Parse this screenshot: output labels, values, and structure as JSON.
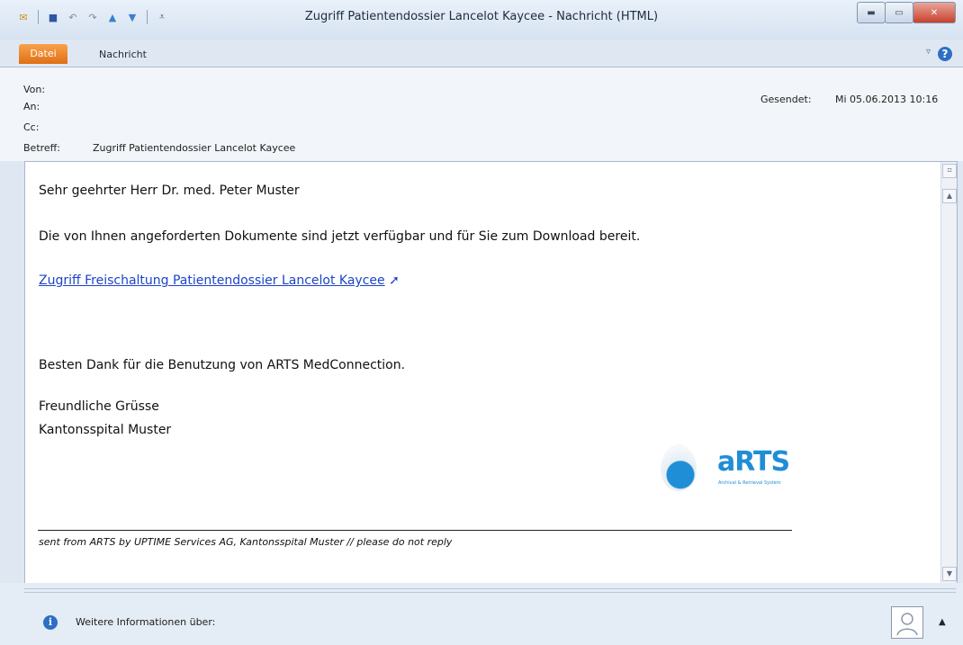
{
  "window": {
    "title": "Zugriff Patientendossier Lancelot Kaycee - Nachricht (HTML)",
    "minimize_glyph": "▬",
    "maximize_glyph": "▭",
    "close_glyph": "✕"
  },
  "qat": {
    "mail_glyph": "✉",
    "save_glyph": "■",
    "undo_glyph": "↶",
    "redo_glyph": "↷",
    "up_glyph": "▲",
    "down_glyph": "▼",
    "customize_glyph": "⩡"
  },
  "ribbon": {
    "tabs": [
      "Datei",
      "Nachricht"
    ],
    "collapse_glyph": "▿",
    "help_glyph": "?"
  },
  "header": {
    "from_label": "Von:",
    "to_label": "An:",
    "cc_label": "Cc:",
    "subject_label": "Betreff:",
    "subject_value": "Zugriff Patientendossier Lancelot Kaycee",
    "sent_label": "Gesendet:",
    "sent_value": "Mi 05.06.2013 10:16"
  },
  "message": {
    "greeting": "Sehr geehrter Herr Dr. med. Peter Muster",
    "line1": "Die von Ihnen angeforderten Dokumente sind jetzt verfügbar und für Sie zum Download bereit.",
    "link_text": "Zugriff Freischaltung Patientendossier Lancelot Kaycee",
    "link_glyph": "➚",
    "thanks": "Besten Dank für die Benutzung von ARTS MedConnection.",
    "closing": "Freundliche Grüsse",
    "sender": "Kantonsspital Muster",
    "footer": "sent from ARTS by UPTIME Services AG, Kantonsspital Muster // please do not reply"
  },
  "logo": {
    "text": "aRTS",
    "subtitle": "Archival & Retrieval System",
    "color": "#1f8ed6"
  },
  "scrollbar": {
    "up_glyph": "▲",
    "down_glyph": "▼"
  },
  "people_pane": {
    "info_glyph": "i",
    "text": "Weitere Informationen über:",
    "expand_glyph": "▲"
  },
  "colors": {
    "accent": "#e06f13",
    "link": "#1b44c8",
    "help": "#2c6fc4"
  }
}
